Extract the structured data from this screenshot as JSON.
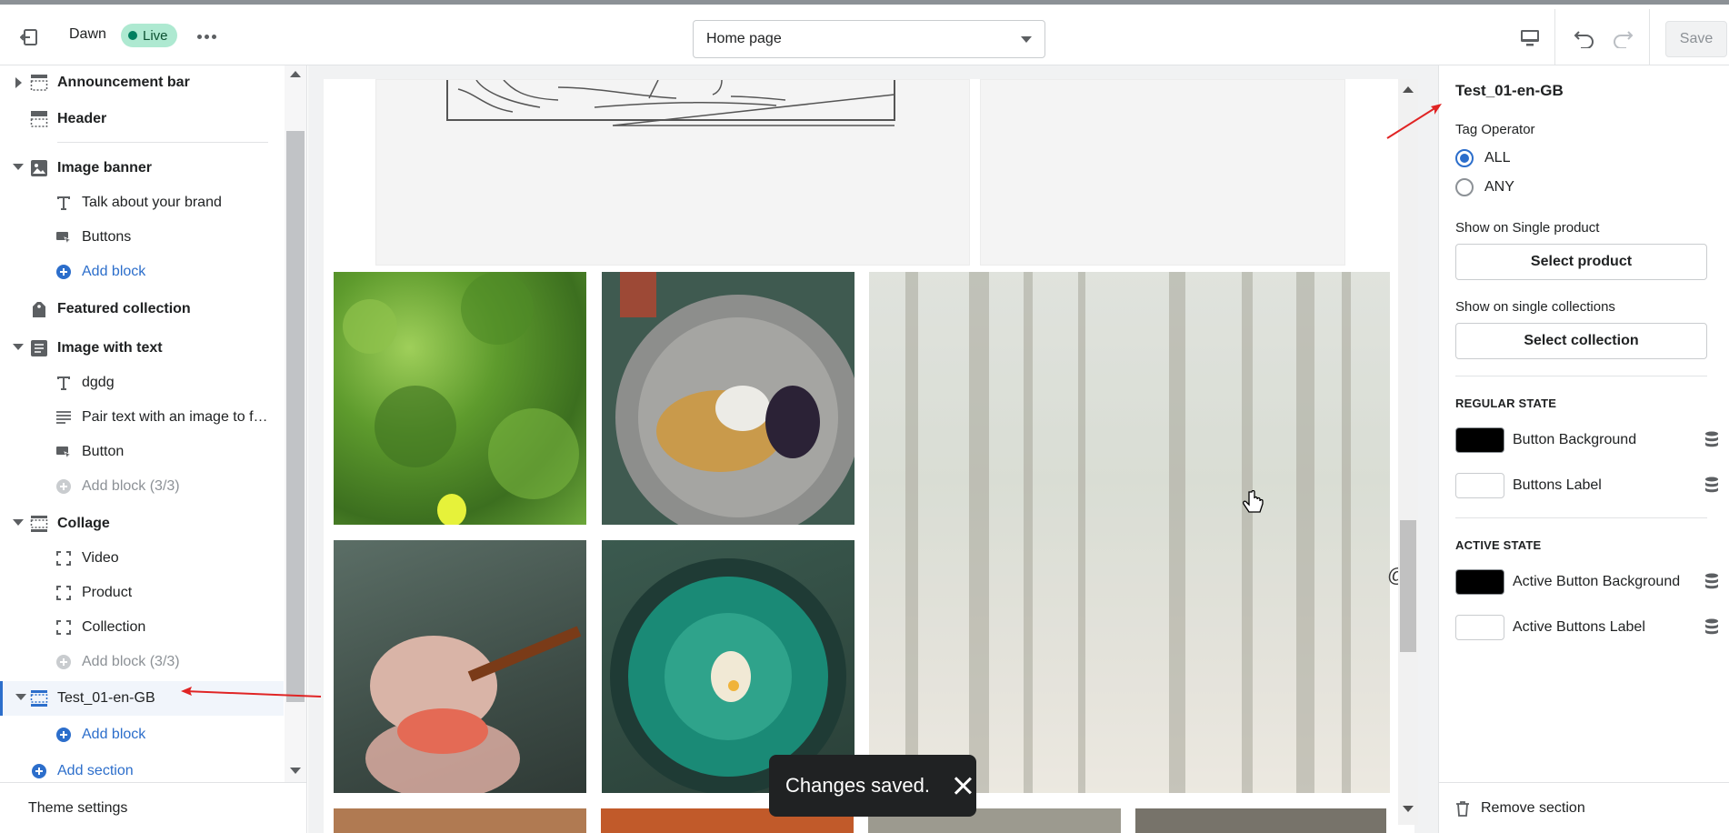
{
  "topbar": {
    "theme_name": "Dawn",
    "live_label": "Live",
    "page_select_value": "Home page",
    "save_label": "Save",
    "icons": [
      "exit-icon",
      "more-icon",
      "desktop-preview-icon",
      "undo-icon",
      "redo-icon"
    ]
  },
  "sidebar": {
    "items": [
      {
        "type": "section",
        "label": "Announcement bar",
        "icon": "section-icon",
        "expanded": false
      },
      {
        "type": "section",
        "label": "Header",
        "icon": "section-icon"
      },
      {
        "type": "section",
        "label": "Image banner",
        "icon": "image-icon",
        "expanded": true
      },
      {
        "type": "block",
        "label": "Talk about your brand",
        "icon": "text-icon"
      },
      {
        "type": "block",
        "label": "Buttons",
        "icon": "button-icon"
      },
      {
        "type": "add",
        "label": "Add block"
      },
      {
        "type": "section",
        "label": "Featured collection",
        "icon": "tag-icon"
      },
      {
        "type": "section",
        "label": "Image with text",
        "icon": "image-text-icon",
        "expanded": true
      },
      {
        "type": "block",
        "label": "dgdg",
        "icon": "text-icon"
      },
      {
        "type": "block",
        "label": "Pair text with an image to fo...",
        "icon": "paragraph-icon"
      },
      {
        "type": "block",
        "label": "Button",
        "icon": "button-icon"
      },
      {
        "type": "add-disabled",
        "label": "Add block (3/3)"
      },
      {
        "type": "section",
        "label": "Collage",
        "icon": "section-icon",
        "expanded": true
      },
      {
        "type": "block",
        "label": "Video",
        "icon": "frame-icon"
      },
      {
        "type": "block",
        "label": "Product",
        "icon": "frame-icon"
      },
      {
        "type": "block",
        "label": "Collection",
        "icon": "frame-icon"
      },
      {
        "type": "add-disabled",
        "label": "Add block (3/3)"
      },
      {
        "type": "section",
        "label": "Test_01-en-GB",
        "icon": "section-icon",
        "expanded": true,
        "selected": true
      },
      {
        "type": "add",
        "label": "Add block"
      },
      {
        "type": "add-section",
        "label": "Add section"
      }
    ],
    "theme_settings": "Theme settings"
  },
  "preview": {
    "handle": "@flowboxdev",
    "toast": "Changes saved."
  },
  "panel": {
    "title": "Test_01-en-GB",
    "tag_operator_label": "Tag Operator",
    "options": [
      "ALL",
      "ANY"
    ],
    "selected_option": "ALL",
    "single_product_label": "Show on Single product",
    "select_product": "Select product",
    "single_collections_label": "Show on single collections",
    "select_collection": "Select collection",
    "regular_heading": "REGULAR STATE",
    "button_background": "Button Background",
    "buttons_label": "Buttons Label",
    "active_heading": "ACTIVE STATE",
    "active_button_background": "Active Button Background",
    "active_buttons_label": "Active Buttons Label",
    "remove_section": "Remove section",
    "colors": {
      "button_background": "#000000",
      "buttons_label": "#ffffff",
      "active_button_background": "#000000",
      "active_buttons_label": "#ffffff"
    }
  },
  "colors": {
    "accent": "#2c6ecb",
    "live_badge": "#aee9d1",
    "annotation_arrow": "#e02424"
  }
}
